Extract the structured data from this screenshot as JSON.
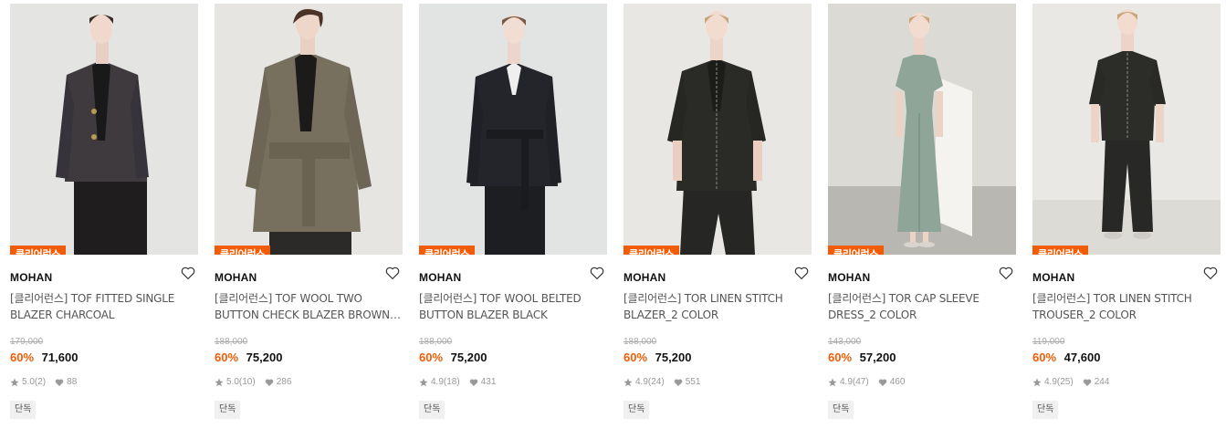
{
  "colors": {
    "badge_bg": "#f25c05",
    "discount_text": "#f25c05",
    "tag_bg": "#f0f0f0"
  },
  "products": [
    {
      "badge": "클리어런스",
      "brand": "MOHAN",
      "name": "[클리어런스] TOF FITTED SINGLE BLAZER CHARCOAL",
      "original_price": "179,000",
      "discount": "60%",
      "price": "71,600",
      "rating": "5.0",
      "reviews": "(2)",
      "likes": "88",
      "tag": "단독",
      "heart_icon": "heart-outline-icon"
    },
    {
      "badge": "클리어런스",
      "brand": "MOHAN",
      "name": "[클리어런스] TOF WOOL TWO BUTTON CHECK BLAZER BROWN CHECK",
      "original_price": "188,000",
      "discount": "60%",
      "price": "75,200",
      "rating": "5.0",
      "reviews": "(10)",
      "likes": "286",
      "tag": "단독",
      "heart_icon": "heart-outline-icon"
    },
    {
      "badge": "클리어런스",
      "brand": "MOHAN",
      "name": "[클리어런스] TOF WOOL BELTED BUTTON BLAZER BLACK",
      "original_price": "188,000",
      "discount": "60%",
      "price": "75,200",
      "rating": "4.9",
      "reviews": "(18)",
      "likes": "431",
      "tag": "단독",
      "heart_icon": "heart-outline-icon"
    },
    {
      "badge": "클리어런스",
      "brand": "MOHAN",
      "name": "[클리어런스] TOR LINEN STITCH BLAZER_2 COLOR",
      "original_price": "188,000",
      "discount": "60%",
      "price": "75,200",
      "rating": "4.9",
      "reviews": "(24)",
      "likes": "551",
      "tag": "단독",
      "heart_icon": "heart-outline-icon"
    },
    {
      "badge": "클리어런스",
      "brand": "MOHAN",
      "name": "[클리어런스] TOR CAP SLEEVE DRESS_2 COLOR",
      "original_price": "143,000",
      "discount": "60%",
      "price": "57,200",
      "rating": "4.9",
      "reviews": "(47)",
      "likes": "460",
      "tag": "단독",
      "heart_icon": "heart-outline-icon"
    },
    {
      "badge": "클리어런스",
      "brand": "MOHAN",
      "name": "[클리어런스] TOR LINEN STITCH TROUSER_2 COLOR",
      "original_price": "119,000",
      "discount": "60%",
      "price": "47,600",
      "rating": "4.9",
      "reviews": "(25)",
      "likes": "244",
      "tag": "단독",
      "heart_icon": "heart-outline-icon"
    }
  ]
}
